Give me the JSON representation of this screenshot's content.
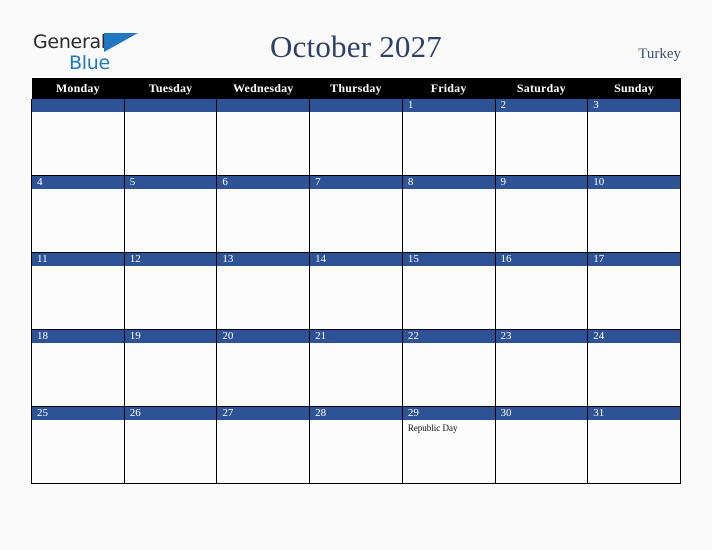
{
  "brand": {
    "name_part1": "General",
    "name_part2": "Blue",
    "triangle_icon": "triangle-icon",
    "color_dark": "#2b2b2b",
    "color_blue": "#1f78c1"
  },
  "header": {
    "title": "October 2027",
    "country": "Turkey",
    "title_color": "#2e4068",
    "country_color": "#3c5278"
  },
  "colors": {
    "page_background": "#fafafa",
    "header_row_background": "#000000",
    "daynum_bar_background": "#2d5396",
    "cell_background": "#fcfcfd",
    "grid_line": "#000000",
    "daynum_text": "#ffffff",
    "event_text": "#111111"
  },
  "weekday_headers": [
    "Monday",
    "Tuesday",
    "Wednesday",
    "Thursday",
    "Friday",
    "Saturday",
    "Sunday"
  ],
  "weeks": [
    [
      {
        "day": "",
        "event": ""
      },
      {
        "day": "",
        "event": ""
      },
      {
        "day": "",
        "event": ""
      },
      {
        "day": "",
        "event": ""
      },
      {
        "day": "1",
        "event": ""
      },
      {
        "day": "2",
        "event": ""
      },
      {
        "day": "3",
        "event": ""
      }
    ],
    [
      {
        "day": "4",
        "event": ""
      },
      {
        "day": "5",
        "event": ""
      },
      {
        "day": "6",
        "event": ""
      },
      {
        "day": "7",
        "event": ""
      },
      {
        "day": "8",
        "event": ""
      },
      {
        "day": "9",
        "event": ""
      },
      {
        "day": "10",
        "event": ""
      }
    ],
    [
      {
        "day": "11",
        "event": ""
      },
      {
        "day": "12",
        "event": ""
      },
      {
        "day": "13",
        "event": ""
      },
      {
        "day": "14",
        "event": ""
      },
      {
        "day": "15",
        "event": ""
      },
      {
        "day": "16",
        "event": ""
      },
      {
        "day": "17",
        "event": ""
      }
    ],
    [
      {
        "day": "18",
        "event": ""
      },
      {
        "day": "19",
        "event": ""
      },
      {
        "day": "20",
        "event": ""
      },
      {
        "day": "21",
        "event": ""
      },
      {
        "day": "22",
        "event": ""
      },
      {
        "day": "23",
        "event": ""
      },
      {
        "day": "24",
        "event": ""
      }
    ],
    [
      {
        "day": "25",
        "event": ""
      },
      {
        "day": "26",
        "event": ""
      },
      {
        "day": "27",
        "event": ""
      },
      {
        "day": "28",
        "event": ""
      },
      {
        "day": "29",
        "event": "Republic Day"
      },
      {
        "day": "30",
        "event": ""
      },
      {
        "day": "31",
        "event": ""
      }
    ]
  ]
}
